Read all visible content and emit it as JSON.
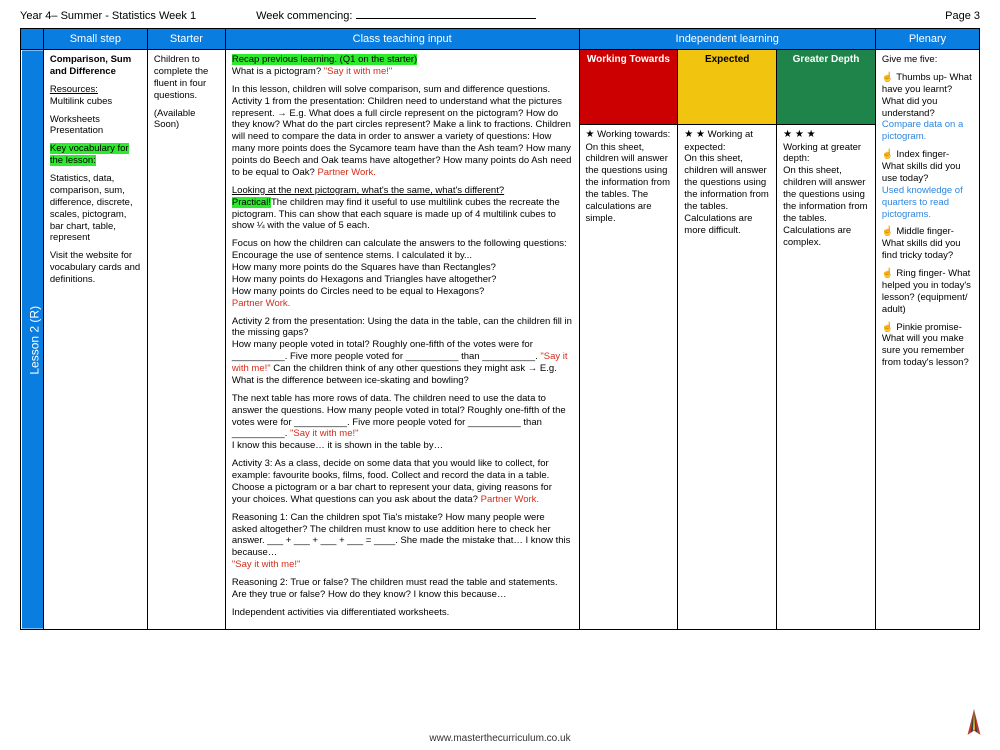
{
  "header": {
    "left": "Year 4– Summer - Statistics Week 1",
    "center_label": "Week commencing:",
    "right": "Page 3"
  },
  "columns": {
    "small_step": "Small step",
    "starter": "Starter",
    "class_teaching": "Class teaching input",
    "independent": "Independent learning",
    "plenary": "Plenary"
  },
  "lesson_label": "Lesson 2 (R)",
  "small_step": {
    "title": "Comparison, Sum and Difference",
    "resources_label": "Resources:",
    "resources_1": "Multilink cubes",
    "resources_2": "Worksheets Presentation",
    "key_vocab_label": "Key vocabulary for the lesson:",
    "vocab": "Statistics, data, comparison, sum, difference, discrete, scales, pictogram, bar chart, table, represent",
    "visit": "Visit the website for vocabulary cards and definitions."
  },
  "starter": {
    "line1": "Children to complete the fluent in four questions.",
    "line2": "(Available Soon)"
  },
  "teaching": {
    "recap": "Recap previous learning. (Q1 on the starter)",
    "q_pictogram": "What is a pictogram? ",
    "say_it": "\"Say it with me!\"",
    "p1": "In this lesson, children will solve comparison, sum and difference questions. Activity 1 from the presentation: Children need to understand what the pictures represent. → E.g. What does a full circle represent on the pictogram? How do they know? What do the part circles represent? Make a link to fractions. Children will need to compare the data in order to answer a variety of questions: How many more points does the Sycamore team have than the Ash team? How many points do Beech and Oak teams have altogether? How many points do Ash need to be equal to Oak? ",
    "partner": "Partner Work.",
    "p2a": "Looking at the next pictogram, what's the same, what's different?",
    "practical": "Practical!",
    "p2b": "The children may find it useful to use multilink cubes the recreate the pictogram. This can show that each square is made up of 4 multilink cubes to show ¼  with the value of 5 each.",
    "p3": "Focus on how the children can calculate the answers to the following questions: Encourage the use of sentence stems. I calculated it by...",
    "p3a": "How many more points do the Squares have than Rectangles?",
    "p3b": "How many points do Hexagons and Triangles have altogether?",
    "p3c": "How many points do Circles need to be equal to Hexagons?",
    "p4": "Activity 2 from the presentation: Using the data in the table, can the children fill in the missing gaps?",
    "p4a": "How many people voted in total? Roughly one-fifth of the votes were for __________. Five more people voted for __________ than __________. ",
    "p4b": " Can the children think of any other questions they might ask → E.g. What is the difference between ice-skating and bowling?",
    "p5": "The next table has more rows of data. The children need to use the data to answer the questions. How many people voted in total? Roughly one-fifth of the votes were for __________. Five more people voted for __________ than __________. ",
    "p5b": "I know this because… it is shown in the table by…",
    "p6": "Activity 3: As a class, decide on some data that you would like to collect, for example: favourite books, films, food.  Collect and record the data in a table. Choose a pictogram or a bar chart to represent your data, giving reasons for your choices. What questions can you ask about the data? ",
    "p7": "Reasoning 1: Can the children spot Tia's mistake? How many people were asked altogether? The children must know to use addition here to check her answer. ___ + ___ + ___ + ___ = ____. She made the mistake that… I know this because… ",
    "p8": "Reasoning 2: True or false? The children must read the table and statements. Are they true or false? How do they know? I know this because…",
    "p9": "Independent activities via differentiated worksheets."
  },
  "independent": {
    "wt_header": "Working Towards",
    "exp_header": "Expected",
    "gd_header": "Greater Depth",
    "wt_title": "Working towards:",
    "wt_body": "On this sheet, children will answer the questions using the information from the tables. The calculations are simple.",
    "exp_title": "Working at expected:",
    "exp_body": "On this sheet, children will answer the questions using the information from the tables. Calculations are more difficult.",
    "gd_title": "Working at greater depth:",
    "gd_body": "On this sheet, children will answer the questions using the information from the tables. Calculations are complex."
  },
  "plenary": {
    "intro": "Give me five:",
    "thumb_label": "☝ Thumbs up- What have you learnt? What did you understand?",
    "thumb_blue": "Compare data on a pictogram.",
    "index_label": "☝ Index finger- What skills did you use today?",
    "index_blue": "Used knowledge of quarters to read pictograms.",
    "middle": "☝ Middle finger- What skills did you find tricky today?",
    "ring": "☝ Ring finger- What helped you in today's lesson? (equipment/ adult)",
    "pinkie": "☝ Pinkie promise- What will you make sure you remember from today's lesson?"
  },
  "footer": "www.masterthecurriculum.co.uk"
}
